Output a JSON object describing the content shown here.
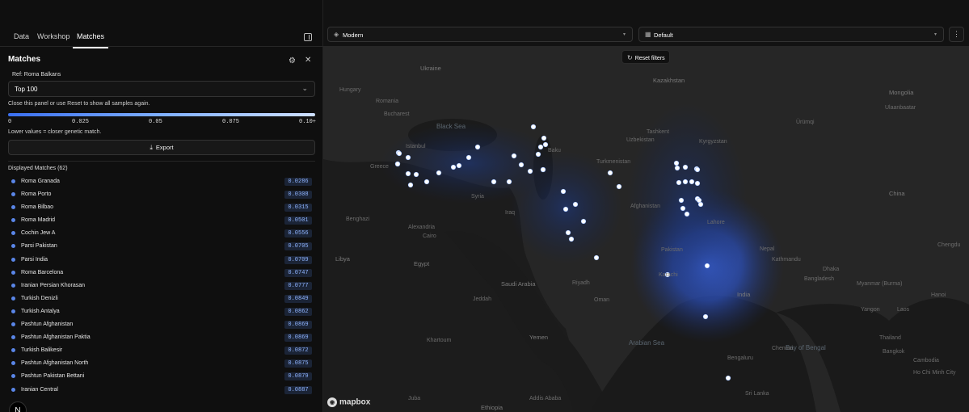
{
  "tabs": [
    {
      "label": "Data"
    },
    {
      "label": "Workshop"
    },
    {
      "label": "Matches"
    }
  ],
  "panel": {
    "title": "Matches",
    "ref_label": "Ref: Roma Balkans",
    "select_value": "Top 100",
    "hint": "Close this panel or use Reset to show all samples again.",
    "ticks": [
      "0",
      "0.025",
      "0.05",
      "0.075",
      "0.10+"
    ],
    "legend_note": "Lower values = closer genetic match.",
    "export_label": "Export",
    "matches_title": "Displayed Matches (62)",
    "accent": "#5a86e8"
  },
  "matches": [
    {
      "name": "Roma Granada",
      "value": "0.0286"
    },
    {
      "name": "Roma Porto",
      "value": "0.0308"
    },
    {
      "name": "Roma Bilbao",
      "value": "0.0315"
    },
    {
      "name": "Roma Madrid",
      "value": "0.0501"
    },
    {
      "name": "Cochin Jew A",
      "value": "0.0556"
    },
    {
      "name": "Parsi Pakistan",
      "value": "0.0705"
    },
    {
      "name": "Parsi India",
      "value": "0.0709"
    },
    {
      "name": "Roma Barcelona",
      "value": "0.0747"
    },
    {
      "name": "Iranian Persian Khorasan",
      "value": "0.0777"
    },
    {
      "name": "Turkish Denizli",
      "value": "0.0849"
    },
    {
      "name": "Turkish Antalya",
      "value": "0.0862"
    },
    {
      "name": "Pashtun Afghanistan",
      "value": "0.0869"
    },
    {
      "name": "Pashtun Afghanistan Paktia",
      "value": "0.0869"
    },
    {
      "name": "Turkish Balikesir",
      "value": "0.0872"
    },
    {
      "name": "Pashtun Afghanistan North",
      "value": "0.0875"
    },
    {
      "name": "Pashtun Pakistan Bettani",
      "value": "0.0879"
    },
    {
      "name": "Iranian Central",
      "value": "0.0887"
    }
  ],
  "map": {
    "style_dropdown": "Modern",
    "view_dropdown": "Default",
    "reset_label": "Reset filters",
    "attribution": "mapbox",
    "places": {
      "ukraine": "Ukraine",
      "kazakhstan": "Kazakhstan",
      "mongolia": "Mongolia",
      "hungary": "Hungary",
      "romania": "Romania",
      "bucharest": "Bucharest",
      "blacksea": "Black Sea",
      "istanbul": "Istanbul",
      "baku": "Baku",
      "tashkent": "Tashkent",
      "urumqi": "Ürümqi",
      "ulaanbaatar": "Ulaanbaatar",
      "uzbekistan": "Uzbekistan",
      "kyrgyzstan": "Kyrgyzstan",
      "turkmenistan": "Turkmenistan",
      "greece": "Greece",
      "syria": "Syria",
      "iraq": "Iraq",
      "china": "China",
      "afghanistan": "Afghanistan",
      "lahore": "Lahore",
      "benghazi": "Benghazi",
      "alexandria": "Alexandria",
      "cairo": "Cairo",
      "egypt": "Egypt",
      "libya": "Libya",
      "pakistan": "Pakistan",
      "nepal": "Nepal",
      "chengdu": "Chengdu",
      "karachi": "Karachi",
      "saudi": "Saudi Arabia",
      "riyadh": "Riyadh",
      "jeddah": "Jeddah",
      "india": "India",
      "bangladesh": "Bangladesh",
      "myanmar": "Myanmar (Burma)",
      "oman": "Oman",
      "yemen": "Yemen",
      "khartoum": "Khartoum",
      "arabiansea": "Arabian Sea",
      "bayofbengal": "Bay of Bengal",
      "ethiopia": "Ethiopia",
      "bengaluru": "Bengaluru",
      "chennai": "Chennai",
      "srilanka": "Sri Lanka",
      "bangkok": "Bangkok",
      "thailand": "Thailand",
      "cambodia": "Cambodia",
      "laos": "Laos",
      "hanoi": "Hanoi",
      "hochiminh": "Ho Chi Minh City",
      "juba": "Juba",
      "addis": "Addis Ababa",
      "yangon": "Yangon",
      "dhaka": "Dhaka",
      "kathmandu": "Kathmandu"
    }
  }
}
